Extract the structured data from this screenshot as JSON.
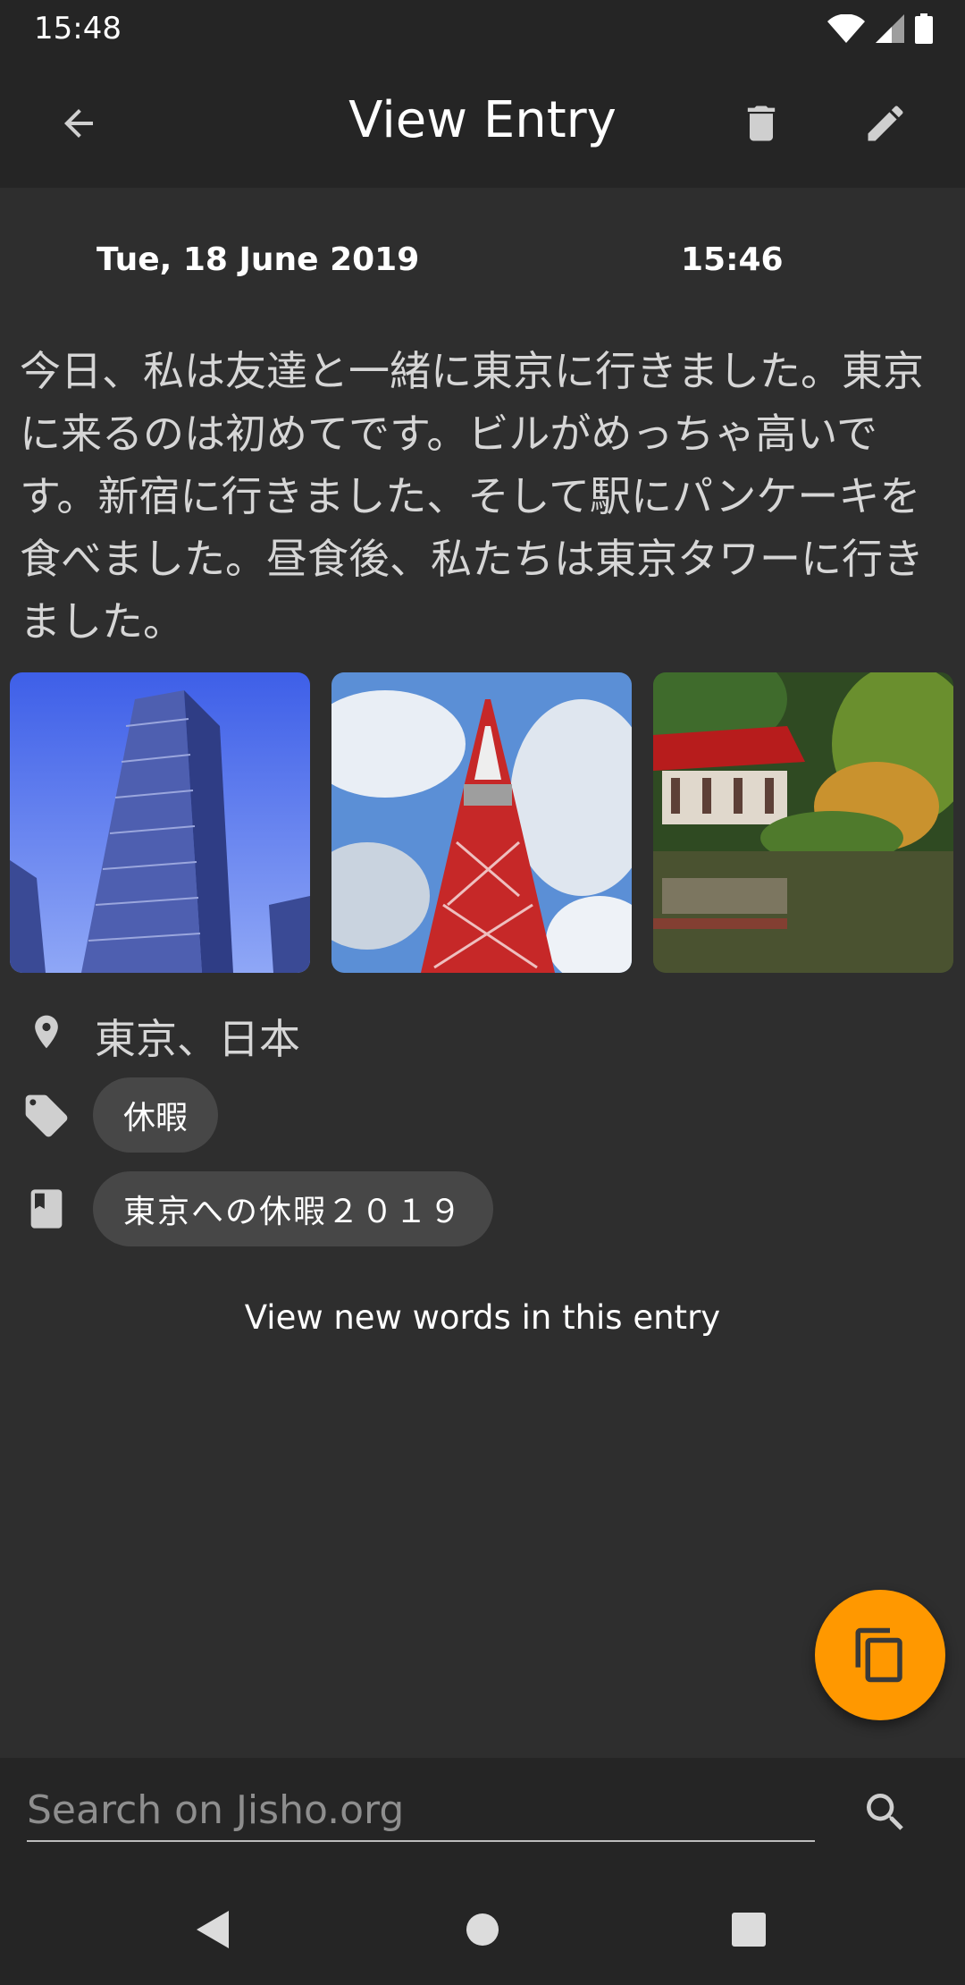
{
  "status_bar": {
    "time": "15:48"
  },
  "app_bar": {
    "title": "View Entry"
  },
  "entry": {
    "date": "Tue, 18 June 2019",
    "time": "15:46",
    "body": "今日、私は友達と一緒に東京に行きました。東京に来るのは初めてです。ビルがめっちゃ高いです。新宿に行きました、そして駅にパンケーキを食べました。昼食後、私たちは東京タワーに行きました。",
    "location": "東京、日本",
    "tag": "休暇",
    "notebook": "東京への休暇２０１９"
  },
  "new_words_link": "View new words in this entry",
  "search": {
    "placeholder": "Search on Jisho.org",
    "value": ""
  },
  "colors": {
    "fab": "#ff9800",
    "background": "#2e2e2e",
    "bar": "#252525",
    "chip": "#474747"
  }
}
